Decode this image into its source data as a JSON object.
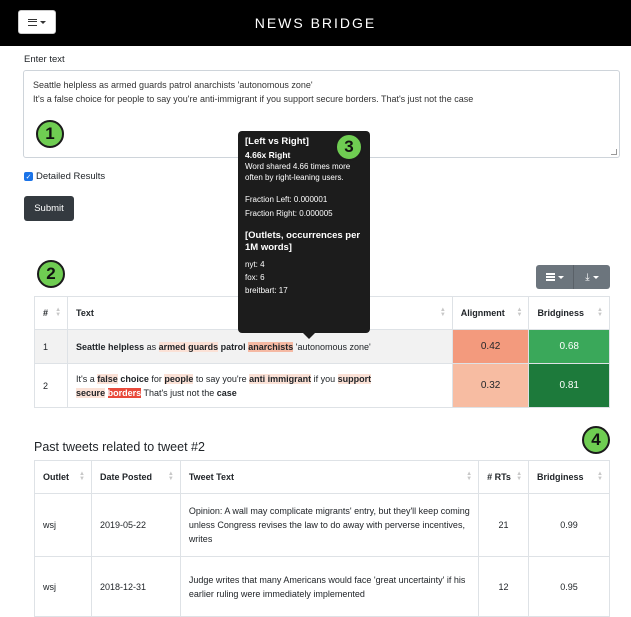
{
  "app": {
    "title": "NEWS BRIDGE"
  },
  "form": {
    "label": "Enter text",
    "lines": [
      "Seattle helpless as armed guards patrol anarchists 'autonomous zone'",
      "It's a false choice for people to say you're anti-immigrant if you support secure borders. That's just not the case"
    ],
    "checkbox_label": "Detailed Results",
    "checkbox_checked": true,
    "submit_label": "Submit"
  },
  "badges": [
    "1",
    "2",
    "3",
    "4"
  ],
  "colors": {
    "navbar": "#000000",
    "badge": "#6fcd52",
    "align_1": "#f39a7d",
    "align_2": "#f7bca2",
    "bridge_1": "#3aa85a",
    "bridge_2": "#1d7a3b"
  },
  "toolbar_icons": [
    "list-icon",
    "download-icon"
  ],
  "results": {
    "headers": [
      "#",
      "Text",
      "Alignment",
      "Bridginess"
    ],
    "rows": [
      {
        "num": "1",
        "alignment": "0.42",
        "bridginess": "0.68"
      },
      {
        "num": "2",
        "alignment": "0.32",
        "bridginess": "0.81"
      }
    ]
  },
  "tooltip": {
    "title": "[Left vs Right]",
    "score": "4.66x Right",
    "desc": "Word shared 4.66 times more often by right-leaning users.",
    "fraction_left": "Fraction Left: 0.000001",
    "fraction_right": "Fraction Right: 0.000005",
    "outlets_title": "[Outlets, occurrences per 1M words]",
    "outlets": [
      "nyt: 4",
      "fox: 6",
      "breitbart: 17"
    ]
  },
  "past": {
    "title": "Past tweets related to tweet #2",
    "headers": [
      "Outlet",
      "Date Posted",
      "Tweet Text",
      "# RTs",
      "Bridginess"
    ],
    "rows": [
      {
        "outlet": "wsj",
        "date": "2019-05-22",
        "text": "Opinion: A wall may complicate migrants' entry, but they'll keep coming unless Congress revises the law to do away with perverse incentives, writes",
        "rts": "21",
        "bridginess": "0.99"
      },
      {
        "outlet": "wsj",
        "date": "2018-12-31",
        "text": "Judge writes that many Americans would face 'great uncertainty' if his earlier ruling were immediately implemented",
        "rts": "12",
        "bridginess": "0.95"
      }
    ]
  }
}
